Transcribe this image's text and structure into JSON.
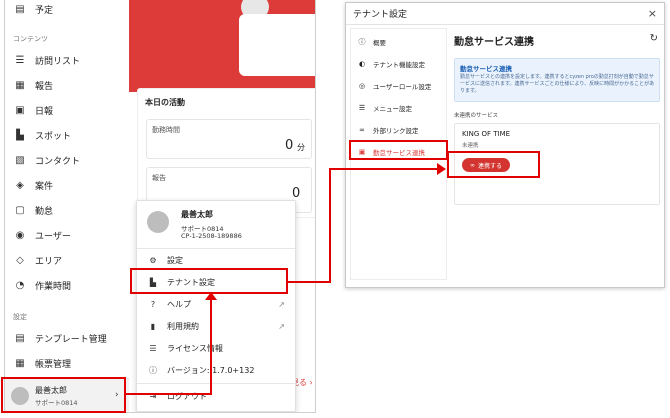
{
  "left": {
    "sidebar": {
      "top_item": "予定",
      "section_contents": "コンテンツ",
      "items": [
        "訪問リスト",
        "報告",
        "日報",
        "スポット",
        "コンタクト",
        "案件",
        "勤怠",
        "ユーザー",
        "エリア",
        "作業時間"
      ],
      "section_settings": "設定",
      "settings_items": [
        "テンプレート管理",
        "帳票管理"
      ],
      "user_name": "最善太郎",
      "user_sub": "サポート0814"
    },
    "activity": {
      "title": "本日の活動",
      "work_label": "勤務時間",
      "work_value": "0",
      "work_unit": "分",
      "report_label": "報告",
      "report_value": "0"
    },
    "see_more": "見る ›",
    "menu": {
      "user_name": "最善太郎",
      "user_sub": "サポート0814",
      "user_id": "CP-1-2508-189886",
      "items": [
        "設定",
        "テナント設定",
        "ヘルプ",
        "利用規約",
        "ライセンス情報",
        "バージョン: 1.7.0+132",
        "ログアウト"
      ]
    }
  },
  "dialog": {
    "title": "テナント設定",
    "nav": [
      "概要",
      "テナント機能設定",
      "ユーザーロール設定",
      "メニュー設定",
      "外部リンク設定",
      "勤怠サービス連携"
    ],
    "heading": "勤怠サービス連携",
    "info_title": "勤怠サービス連携",
    "info_text": "勤怠サービスとの連携を設定します。連携するとcyzen proの勤怠打刻が自動で勤怠サービスに送信されます。連携サービスごとの仕様により、反映に時間がかかることがあります。",
    "section_label": "未連携のサービス",
    "service_name": "KING OF TIME",
    "service_status": "未連携",
    "connect_button": "連携する"
  },
  "colors": {
    "brand_red": "#dd3a3a",
    "annotation_red": "#e00000",
    "info_blue": "#e9f2fd"
  }
}
